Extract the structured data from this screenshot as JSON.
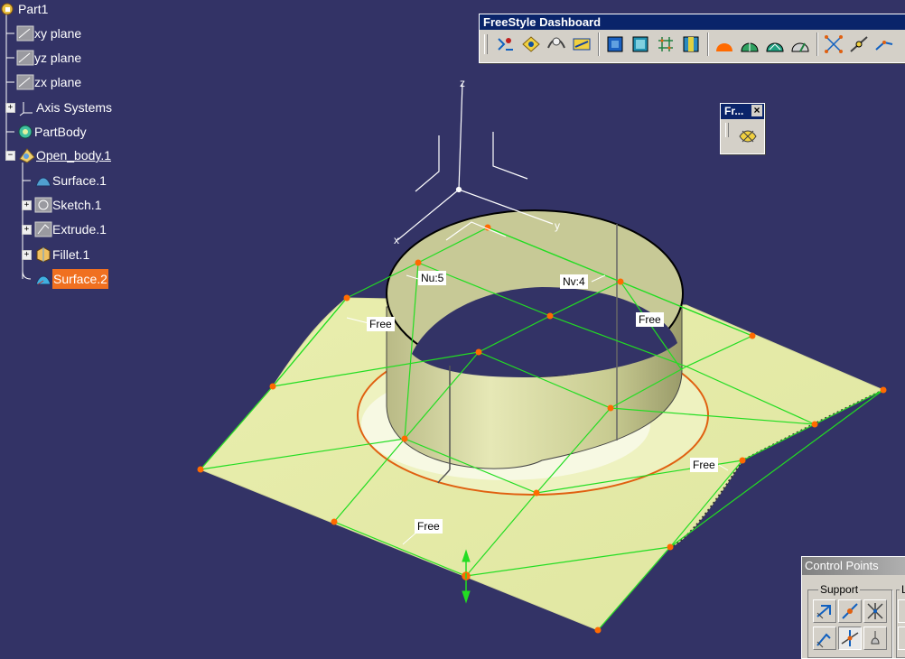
{
  "tree": {
    "root": "Part1",
    "planes": [
      "xy plane",
      "yz plane",
      "zx plane"
    ],
    "axis_systems": "Axis Systems",
    "part_body": "PartBody",
    "open_body": "Open_body.1",
    "children": [
      "Surface.1",
      "Sketch.1",
      "Extrude.1",
      "Fillet.1",
      "Surface.2"
    ],
    "expand_collapsed": "+",
    "expand_open": "−"
  },
  "toolbars": {
    "dashboard_title": "FreeStyle Dashboard",
    "mini_title": "Fr...",
    "mini_close": "×",
    "control_points_title": "Control Points",
    "support_label": "Support",
    "second_group_label": "L"
  },
  "viewport": {
    "axis_z": "z",
    "axis_y": "y",
    "axis_x": "x",
    "nu_label": "Nu:5",
    "nv_label": "Nv:4",
    "free_labels": [
      "Free",
      "Free",
      "Free",
      "Free"
    ]
  },
  "colors": {
    "background": "#333366",
    "surface": "#e6eca8",
    "control_net": "#00ff00",
    "control_point": "#ff6a00",
    "selected": "#f07020"
  }
}
